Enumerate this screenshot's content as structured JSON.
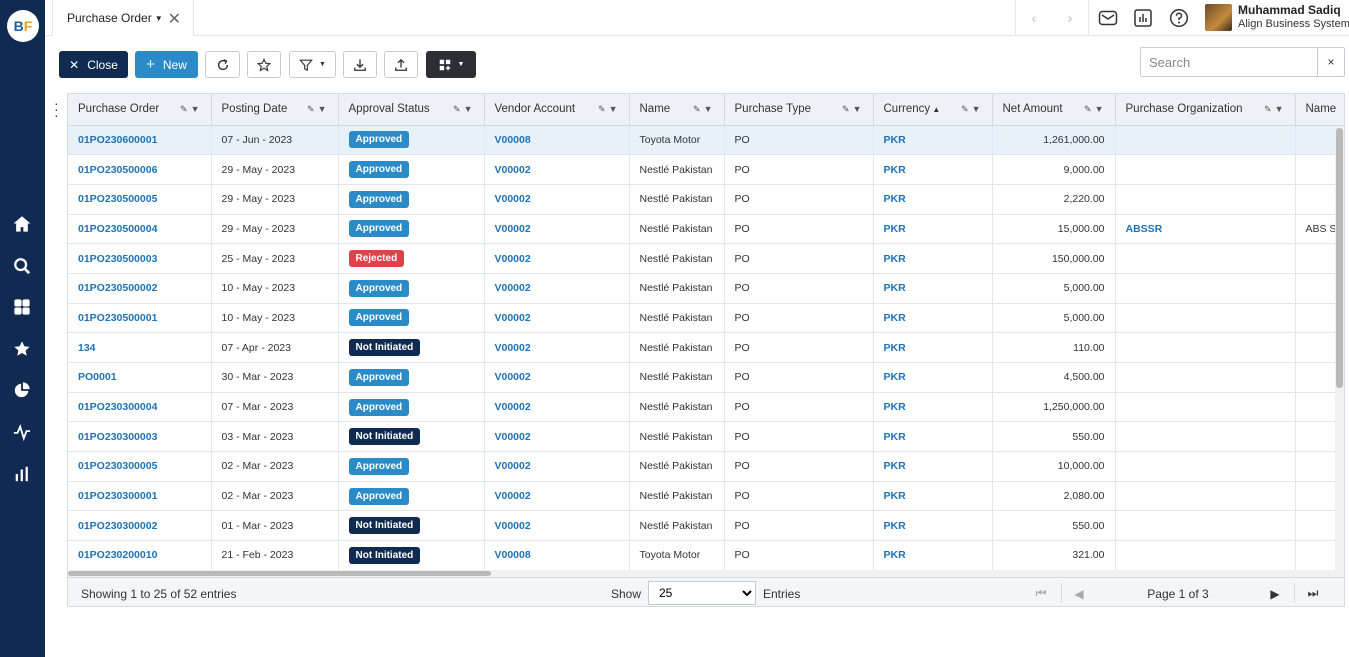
{
  "app": {
    "logo_b": "B",
    "logo_f": "F"
  },
  "tab": {
    "label": "Purchase Order"
  },
  "user": {
    "name": "Muhammad Sadiq",
    "company": "Align Business Systems"
  },
  "toolbar": {
    "close_label": "Close",
    "new_label": "New"
  },
  "search": {
    "placeholder": "Search",
    "clear": "×"
  },
  "table": {
    "columns": [
      "Purchase Order",
      "Posting Date",
      "Approval Status",
      "Vendor Account",
      "Name",
      "Purchase Type",
      "Currency",
      "Net Amount",
      "Purchase Organization",
      "Name"
    ],
    "rows": [
      {
        "po": "01PO230600001",
        "date": "07 - Jun - 2023",
        "status": "Approved",
        "vendor": "V00008",
        "name": "Toyota Motor",
        "type": "PO",
        "currency": "PKR",
        "amount": "1,261,000.00",
        "org": "",
        "org_name": ""
      },
      {
        "po": "01PO230500006",
        "date": "29 - May - 2023",
        "status": "Approved",
        "vendor": "V00002",
        "name": "Nestlé Pakistan",
        "type": "PO",
        "currency": "PKR",
        "amount": "9,000.00",
        "org": "",
        "org_name": ""
      },
      {
        "po": "01PO230500005",
        "date": "29 - May - 2023",
        "status": "Approved",
        "vendor": "V00002",
        "name": "Nestlé Pakistan",
        "type": "PO",
        "currency": "PKR",
        "amount": "2,220.00",
        "org": "",
        "org_name": ""
      },
      {
        "po": "01PO230500004",
        "date": "29 - May - 2023",
        "status": "Approved",
        "vendor": "V00002",
        "name": "Nestlé Pakistan",
        "type": "PO",
        "currency": "PKR",
        "amount": "15,000.00",
        "org": "ABSSR",
        "org_name": "ABS So"
      },
      {
        "po": "01PO230500003",
        "date": "25 - May - 2023",
        "status": "Rejected",
        "vendor": "V00002",
        "name": "Nestlé Pakistan",
        "type": "PO",
        "currency": "PKR",
        "amount": "150,000.00",
        "org": "",
        "org_name": ""
      },
      {
        "po": "01PO230500002",
        "date": "10 - May - 2023",
        "status": "Approved",
        "vendor": "V00002",
        "name": "Nestlé Pakistan",
        "type": "PO",
        "currency": "PKR",
        "amount": "5,000.00",
        "org": "",
        "org_name": ""
      },
      {
        "po": "01PO230500001",
        "date": "10 - May - 2023",
        "status": "Approved",
        "vendor": "V00002",
        "name": "Nestlé Pakistan",
        "type": "PO",
        "currency": "PKR",
        "amount": "5,000.00",
        "org": "",
        "org_name": ""
      },
      {
        "po": "134",
        "date": "07 - Apr - 2023",
        "status": "Not Initiated",
        "vendor": "V00002",
        "name": "Nestlé Pakistan",
        "type": "PO",
        "currency": "PKR",
        "amount": "110.00",
        "org": "",
        "org_name": ""
      },
      {
        "po": "PO0001",
        "date": "30 - Mar - 2023",
        "status": "Approved",
        "vendor": "V00002",
        "name": "Nestlé Pakistan",
        "type": "PO",
        "currency": "PKR",
        "amount": "4,500.00",
        "org": "",
        "org_name": ""
      },
      {
        "po": "01PO230300004",
        "date": "07 - Mar - 2023",
        "status": "Approved",
        "vendor": "V00002",
        "name": "Nestlé Pakistan",
        "type": "PO",
        "currency": "PKR",
        "amount": "1,250,000.00",
        "org": "",
        "org_name": ""
      },
      {
        "po": "01PO230300003",
        "date": "03 - Mar - 2023",
        "status": "Not Initiated",
        "vendor": "V00002",
        "name": "Nestlé Pakistan",
        "type": "PO",
        "currency": "PKR",
        "amount": "550.00",
        "org": "",
        "org_name": ""
      },
      {
        "po": "01PO230300005",
        "date": "02 - Mar - 2023",
        "status": "Approved",
        "vendor": "V00002",
        "name": "Nestlé Pakistan",
        "type": "PO",
        "currency": "PKR",
        "amount": "10,000.00",
        "org": "",
        "org_name": ""
      },
      {
        "po": "01PO230300001",
        "date": "02 - Mar - 2023",
        "status": "Approved",
        "vendor": "V00002",
        "name": "Nestlé Pakistan",
        "type": "PO",
        "currency": "PKR",
        "amount": "2,080.00",
        "org": "",
        "org_name": ""
      },
      {
        "po": "01PO230300002",
        "date": "01 - Mar - 2023",
        "status": "Not Initiated",
        "vendor": "V00002",
        "name": "Nestlé Pakistan",
        "type": "PO",
        "currency": "PKR",
        "amount": "550.00",
        "org": "",
        "org_name": ""
      },
      {
        "po": "01PO230200010",
        "date": "21 - Feb - 2023",
        "status": "Not Initiated",
        "vendor": "V00008",
        "name": "Toyota Motor",
        "type": "PO",
        "currency": "PKR",
        "amount": "321.00",
        "org": "",
        "org_name": ""
      }
    ]
  },
  "footer": {
    "info": "Showing 1 to 25 of 52 entries",
    "show_label": "Show",
    "page_size": "25",
    "entries_label": "Entries",
    "page_text": "Page 1 of 3"
  },
  "colors": {
    "sidebar": "#102a52",
    "accent": "#2a8bc8",
    "approved": "#2a8bc8",
    "rejected": "#e0424b",
    "not_initiated": "#102a52"
  }
}
